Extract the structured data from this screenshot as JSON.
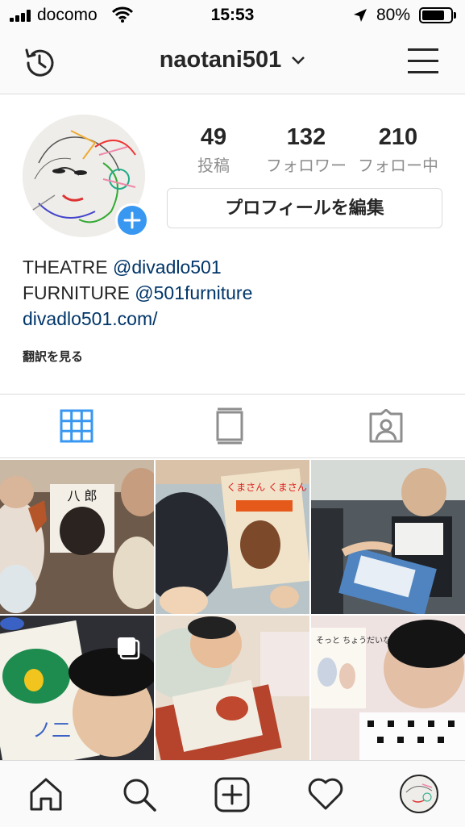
{
  "status_bar": {
    "carrier": "docomo",
    "time": "15:53",
    "battery": "80%",
    "battery_level": 0.8,
    "icons": [
      "signal-icon",
      "wifi-icon",
      "location-arrow-icon",
      "battery-icon"
    ]
  },
  "header": {
    "username": "naotani501",
    "left_icon": "history-icon",
    "right_icon": "menu-icon",
    "dropdown_icon": "chevron-down-icon"
  },
  "profile": {
    "stats": [
      {
        "value": "49",
        "label": "投稿"
      },
      {
        "value": "132",
        "label": "フォロワー"
      },
      {
        "value": "210",
        "label": "フォロー中"
      }
    ],
    "edit_button": "プロフィールを編集",
    "bio": {
      "line1_text": "THEATRE ",
      "line1_link": "@divadlo501",
      "line2_text": "FURNITURE ",
      "line2_link": "@501furniture",
      "website": "divadlo501.com/"
    },
    "translate": "翻訳を見る"
  },
  "tabs": [
    {
      "icon": "grid-icon",
      "active": true
    },
    {
      "icon": "feed-icon",
      "active": false
    },
    {
      "icon": "tagged-icon",
      "active": false
    }
  ],
  "posts": {
    "book_text_1": "八 郎",
    "book_text_2": "くまさん くまさん",
    "book_text_3": "そっと ちょうだいな",
    "book_text_4": "ノ二 ノ二"
  },
  "bottom_nav": [
    {
      "icon": "home-icon"
    },
    {
      "icon": "search-icon"
    },
    {
      "icon": "new-post-icon"
    },
    {
      "icon": "activity-heart-icon"
    },
    {
      "icon": "profile-avatar-icon"
    }
  ],
  "colors": {
    "accent": "#3897f0",
    "link": "#003569",
    "text": "#262626",
    "muted": "#8e8e8e",
    "border": "#dbdbdb"
  }
}
